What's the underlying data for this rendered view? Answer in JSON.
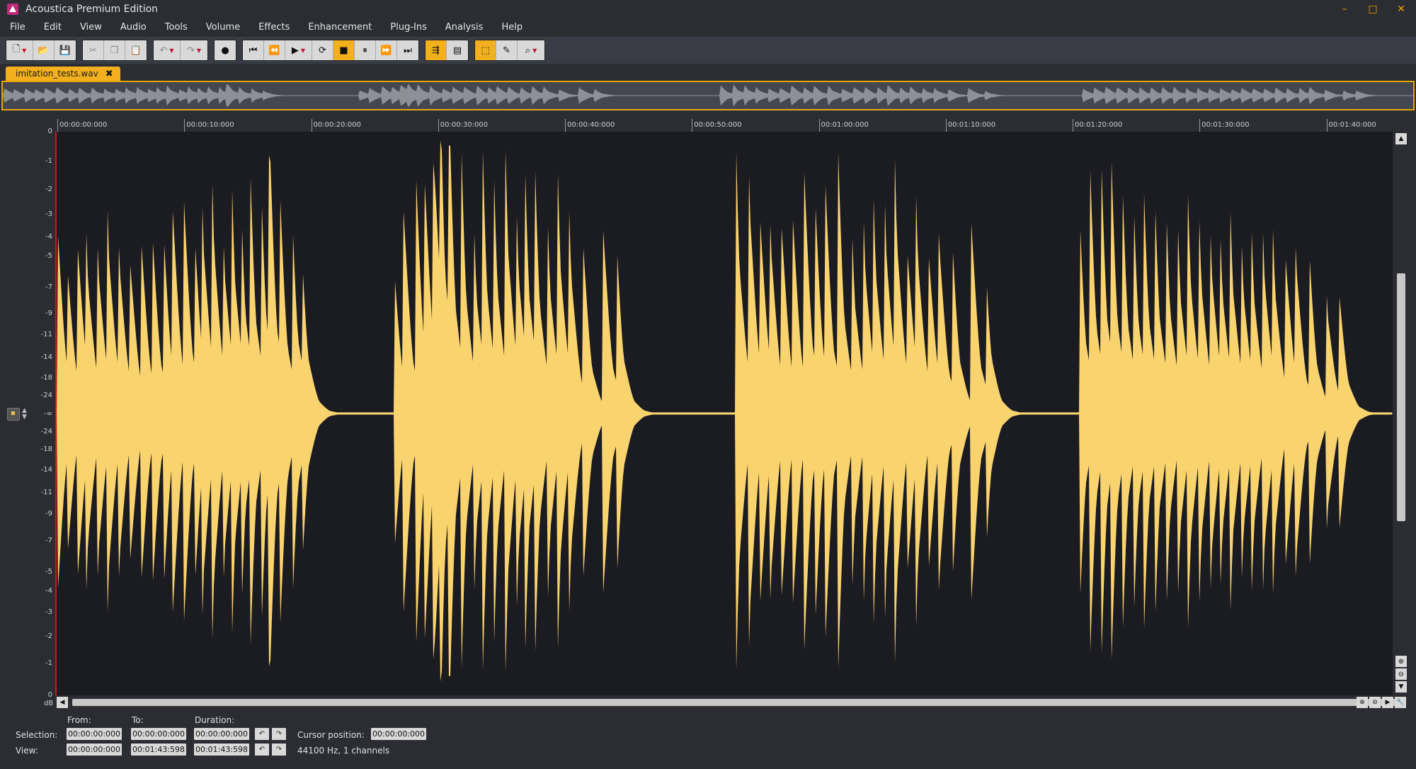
{
  "app": {
    "title": "Acoustica Premium Edition"
  },
  "window": {
    "minimize": "–",
    "maximize": "□",
    "close": "✕"
  },
  "menu": [
    "File",
    "Edit",
    "View",
    "Audio",
    "Tools",
    "Volume",
    "Effects",
    "Enhancement",
    "Plug-Ins",
    "Analysis",
    "Help"
  ],
  "toolbar": {
    "groups": [
      [
        {
          "name": "new-file",
          "glyph": "🗋",
          "caret": true
        },
        {
          "name": "open-folder",
          "glyph": "📂"
        },
        {
          "name": "save",
          "glyph": "💾"
        }
      ],
      [
        {
          "name": "cut",
          "glyph": "✂",
          "dim": true
        },
        {
          "name": "copy",
          "glyph": "❐",
          "dim": true
        },
        {
          "name": "paste",
          "glyph": "📋"
        }
      ],
      [
        {
          "name": "undo",
          "glyph": "↶",
          "caret": true,
          "dim": true
        },
        {
          "name": "redo",
          "glyph": "↷",
          "caret": true,
          "dim": true
        }
      ],
      [
        {
          "name": "record",
          "glyph": "●"
        }
      ],
      [
        {
          "name": "go-to-start",
          "glyph": "⏮"
        },
        {
          "name": "rewind",
          "glyph": "⏪"
        },
        {
          "name": "play",
          "glyph": "▶",
          "caret": true
        },
        {
          "name": "loop",
          "glyph": "⟳"
        },
        {
          "name": "stop",
          "glyph": "■",
          "active": true
        },
        {
          "name": "pause",
          "glyph": "⏸"
        },
        {
          "name": "fast-forward",
          "glyph": "⏩"
        },
        {
          "name": "go-to-end",
          "glyph": "⏭"
        }
      ],
      [
        {
          "name": "follow-playback",
          "glyph": "⇶",
          "active": true
        },
        {
          "name": "spectrogram-toggle",
          "glyph": "▤"
        }
      ],
      [
        {
          "name": "select-tool",
          "glyph": "⬚",
          "active": true
        },
        {
          "name": "pencil-tool",
          "glyph": "✎"
        },
        {
          "name": "zoom-tool",
          "glyph": "⌕",
          "caret": true
        }
      ]
    ]
  },
  "tabs": [
    {
      "label": "imitation_tests.wav",
      "close": "✖"
    }
  ],
  "ruler": {
    "labels": [
      "00:00:00:000",
      "00:00:10:000",
      "00:00:20:000",
      "00:00:30:000",
      "00:00:40:000",
      "00:00:50:000",
      "00:01:00:000",
      "00:01:10:000",
      "00:01:20:000",
      "00:01:30:000",
      "00:01:40:000"
    ],
    "step_seconds": 10,
    "total_seconds": 103.598
  },
  "db_axis": {
    "labels": [
      "0",
      "-1",
      "-2",
      "-3",
      "-4",
      "-5",
      "-7",
      "-9",
      "-11",
      "-14",
      "-18",
      "-24",
      "-∞",
      "-24",
      "-18",
      "-14",
      "-11",
      "-9",
      "-7",
      "-5",
      "-4",
      "-3",
      "-2",
      "-1",
      "0"
    ],
    "unit": "dB"
  },
  "waveform": {
    "color": "#f9d36e",
    "overview_color": "#8e9097",
    "events": [
      {
        "t": 0.1,
        "a": 0.72
      },
      {
        "t": 0.8,
        "a": 0.45
      },
      {
        "t": 1.6,
        "a": 0.6
      },
      {
        "t": 2.3,
        "a": 0.5
      },
      {
        "t": 3.1,
        "a": 0.62
      },
      {
        "t": 3.9,
        "a": 0.7
      },
      {
        "t": 4.8,
        "a": 0.55
      },
      {
        "t": 5.6,
        "a": 0.6
      },
      {
        "t": 6.5,
        "a": 0.65
      },
      {
        "t": 7.4,
        "a": 0.6
      },
      {
        "t": 8.3,
        "a": 0.55
      },
      {
        "t": 9.0,
        "a": 0.65
      },
      {
        "t": 9.8,
        "a": 0.78
      },
      {
        "t": 10.7,
        "a": 0.52
      },
      {
        "t": 11.3,
        "a": 0.6
      },
      {
        "t": 12.0,
        "a": 0.8
      },
      {
        "t": 12.9,
        "a": 0.55
      },
      {
        "t": 13.6,
        "a": 0.65
      },
      {
        "t": 14.3,
        "a": 0.55
      },
      {
        "t": 15.0,
        "a": 0.7
      },
      {
        "t": 15.9,
        "a": 0.6
      },
      {
        "t": 16.4,
        "a": 0.97
      },
      {
        "t": 17.3,
        "a": 0.62
      },
      {
        "t": 18.3,
        "a": 0.55
      },
      {
        "t": 19.1,
        "a": 0.35
      },
      {
        "t": 26.2,
        "a": 0.55
      },
      {
        "t": 26.9,
        "a": 0.7
      },
      {
        "t": 27.8,
        "a": 0.88
      },
      {
        "t": 28.5,
        "a": 0.75
      },
      {
        "t": 29.2,
        "a": 0.98
      },
      {
        "t": 29.7,
        "a": 0.8
      },
      {
        "t": 30.4,
        "a": 0.85
      },
      {
        "t": 31.4,
        "a": 0.75
      },
      {
        "t": 32.3,
        "a": 0.62
      },
      {
        "t": 33.0,
        "a": 0.82
      },
      {
        "t": 33.9,
        "a": 0.7
      },
      {
        "t": 34.8,
        "a": 0.85
      },
      {
        "t": 35.6,
        "a": 0.65
      },
      {
        "t": 36.3,
        "a": 0.7
      },
      {
        "t": 37.1,
        "a": 0.68
      },
      {
        "t": 38.0,
        "a": 0.68
      },
      {
        "t": 38.8,
        "a": 0.82
      },
      {
        "t": 39.7,
        "a": 0.65
      },
      {
        "t": 40.8,
        "a": 0.6
      },
      {
        "t": 42.3,
        "a": 0.85
      },
      {
        "t": 43.4,
        "a": 0.55
      },
      {
        "t": 52.7,
        "a": 0.98
      },
      {
        "t": 53.6,
        "a": 0.95
      },
      {
        "t": 54.5,
        "a": 0.7
      },
      {
        "t": 55.3,
        "a": 0.62
      },
      {
        "t": 56.2,
        "a": 0.65
      },
      {
        "t": 57.0,
        "a": 0.75
      },
      {
        "t": 57.9,
        "a": 0.9
      },
      {
        "t": 58.8,
        "a": 0.65
      },
      {
        "t": 59.6,
        "a": 0.72
      },
      {
        "t": 60.6,
        "a": 0.82
      },
      {
        "t": 61.6,
        "a": 0.65
      },
      {
        "t": 62.5,
        "a": 0.72
      },
      {
        "t": 63.3,
        "a": 0.7
      },
      {
        "t": 64.2,
        "a": 0.7
      },
      {
        "t": 65.0,
        "a": 0.78
      },
      {
        "t": 65.9,
        "a": 0.6
      },
      {
        "t": 66.6,
        "a": 0.7
      },
      {
        "t": 67.6,
        "a": 0.55
      },
      {
        "t": 68.4,
        "a": 0.6
      },
      {
        "t": 69.4,
        "a": 0.6
      },
      {
        "t": 70.9,
        "a": 0.78
      },
      {
        "t": 72.1,
        "a": 0.4
      },
      {
        "t": 79.3,
        "a": 0.78
      },
      {
        "t": 80.1,
        "a": 0.8
      },
      {
        "t": 81.0,
        "a": 0.75
      },
      {
        "t": 81.8,
        "a": 0.7
      },
      {
        "t": 82.6,
        "a": 0.7
      },
      {
        "t": 83.5,
        "a": 0.62
      },
      {
        "t": 84.3,
        "a": 0.65
      },
      {
        "t": 85.1,
        "a": 0.7
      },
      {
        "t": 86.0,
        "a": 0.65
      },
      {
        "t": 86.9,
        "a": 0.62
      },
      {
        "t": 87.7,
        "a": 0.68
      },
      {
        "t": 88.6,
        "a": 0.58
      },
      {
        "t": 89.4,
        "a": 0.65
      },
      {
        "t": 90.2,
        "a": 0.55
      },
      {
        "t": 91.0,
        "a": 0.62
      },
      {
        "t": 91.8,
        "a": 0.6
      },
      {
        "t": 92.6,
        "a": 0.6
      },
      {
        "t": 93.5,
        "a": 0.62
      },
      {
        "t": 94.3,
        "a": 0.55
      },
      {
        "t": 95.2,
        "a": 0.65
      },
      {
        "t": 96.0,
        "a": 0.6
      },
      {
        "t": 97.1,
        "a": 0.55
      },
      {
        "t": 98.4,
        "a": 0.5
      },
      {
        "t": 99.4,
        "a": 0.45
      }
    ]
  },
  "scroll": {
    "up": "▲",
    "down": "▼",
    "left": "◀",
    "right": "▶",
    "zoom_in": "⊕",
    "zoom_out": "⊖",
    "settings": "🔧"
  },
  "bottom": {
    "from_label": "From:",
    "to_label": "To:",
    "duration_label": "Duration:",
    "selection_label": "Selection:",
    "view_label": "View:",
    "selection": {
      "from": "00:00:00:000",
      "to": "00:00:00:000",
      "duration": "00:00:00:000"
    },
    "view": {
      "from": "00:00:00:000",
      "to": "00:01:43:598",
      "duration": "00:01:43:598"
    },
    "undo": "↶",
    "redo": "↷",
    "cursor_label": "Cursor position:",
    "cursor_value": "00:00:00:000",
    "format_info": "44100 Hz, 1 channels"
  }
}
